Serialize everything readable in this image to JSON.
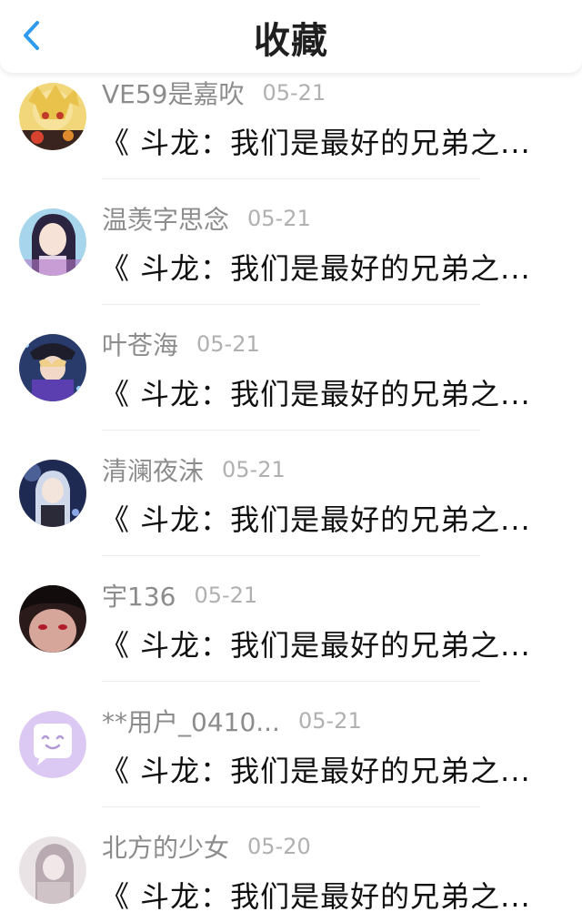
{
  "header": {
    "title": "收藏",
    "back_icon": "chevron-left-icon",
    "accent": "#2f9bf0"
  },
  "items": [
    {
      "username": "VE59是嘉吹",
      "date": "05-21",
      "title": "《 斗龙：我们是最好的兄弟之..."
    },
    {
      "username": "温羡字思念",
      "date": "05-21",
      "title": "《 斗龙：我们是最好的兄弟之..."
    },
    {
      "username": "叶苍海",
      "date": "05-21",
      "title": "《 斗龙：我们是最好的兄弟之..."
    },
    {
      "username": "清澜夜沫",
      "date": "05-21",
      "title": "《 斗龙：我们是最好的兄弟之..."
    },
    {
      "username": "宇136",
      "date": "05-21",
      "title": "《 斗龙：我们是最好的兄弟之..."
    },
    {
      "username": "**用户_0410...",
      "date": "05-21",
      "title": "《 斗龙：我们是最好的兄弟之..."
    },
    {
      "username": "北方的少女",
      "date": "05-20",
      "title": "《 斗龙：我们是最好的兄弟之..."
    }
  ]
}
